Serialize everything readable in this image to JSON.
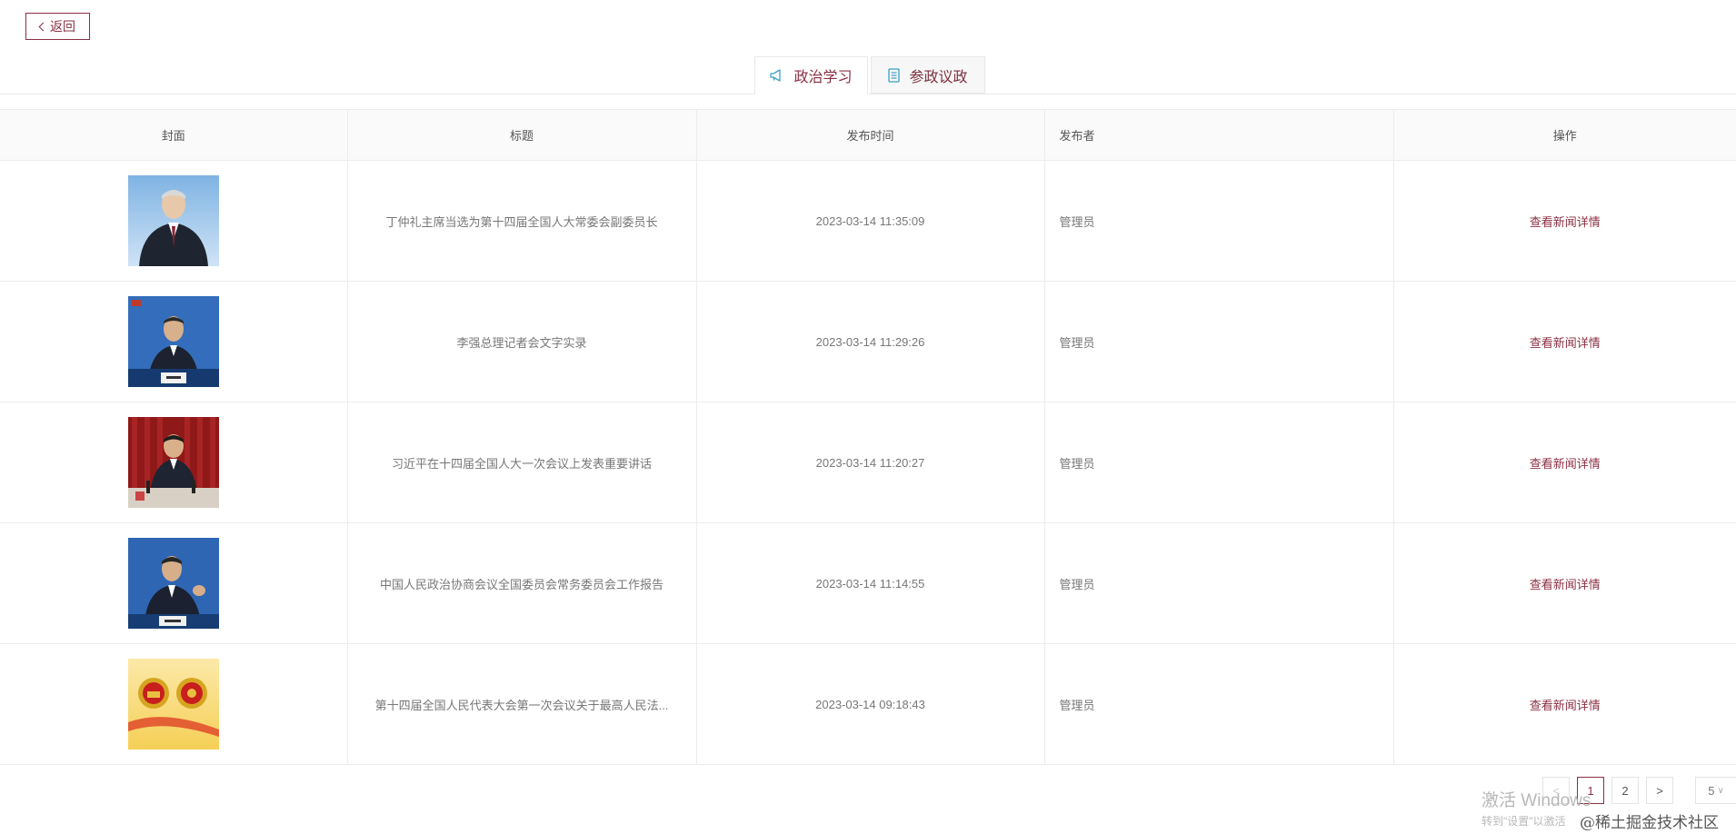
{
  "back_button": {
    "label": "返回"
  },
  "tabs": [
    {
      "label": "政治学习",
      "icon": "megaphone-icon",
      "active": true
    },
    {
      "label": "参政议政",
      "icon": "document-icon",
      "active": false
    }
  ],
  "table": {
    "headers": {
      "cover": "封面",
      "title": "标题",
      "time": "发布时间",
      "publisher": "发布者",
      "action": "操作"
    },
    "rows": [
      {
        "title": "丁仲礼主席当选为第十四届全国人大常委会副委员长",
        "time": "2023-03-14 11:35:09",
        "publisher": "管理员",
        "action": "查看新闻详情",
        "thumb_style": "portrait-blue"
      },
      {
        "title": "李强总理记者会文字实录",
        "time": "2023-03-14 11:29:26",
        "publisher": "管理员",
        "action": "查看新闻详情",
        "thumb_style": "press-blue"
      },
      {
        "title": "习近平在十四届全国人大一次会议上发表重要讲话",
        "time": "2023-03-14 11:20:27",
        "publisher": "管理员",
        "action": "查看新闻详情",
        "thumb_style": "speech-red"
      },
      {
        "title": "中国人民政治协商会议全国委员会常务委员会工作报告",
        "time": "2023-03-14 11:14:55",
        "publisher": "管理员",
        "action": "查看新闻详情",
        "thumb_style": "press-blue"
      },
      {
        "title": "第十四届全国人民代表大会第一次会议关于最高人民法...",
        "time": "2023-03-14 09:18:43",
        "publisher": "管理员",
        "action": "查看新闻详情",
        "thumb_style": "emblem-yellow"
      }
    ]
  },
  "pagination": {
    "prev": "<",
    "pages": [
      "1",
      "2"
    ],
    "current": "1",
    "next": ">",
    "page_size": "5"
  },
  "watermarks": {
    "activate_line1": "激活 Windows",
    "activate_line2": "转到\"设置\"以激活",
    "site": "@稀土掘金技术社区"
  },
  "colors": {
    "accent": "#8b2f43"
  }
}
